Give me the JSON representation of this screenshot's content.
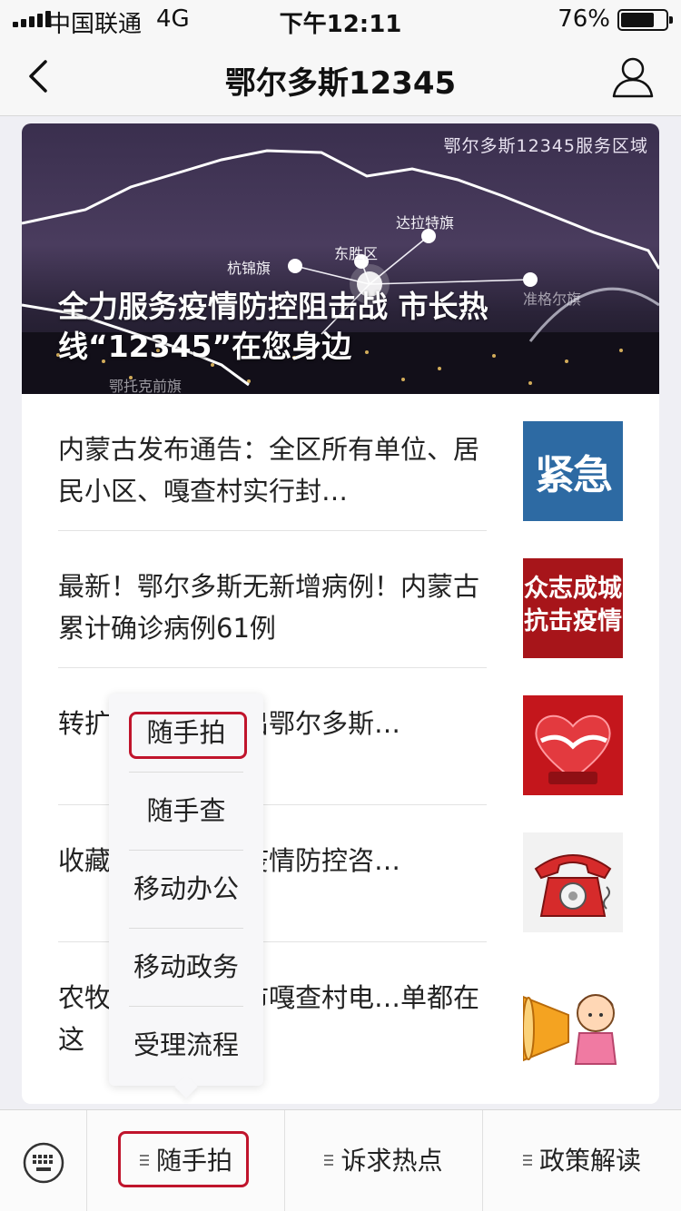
{
  "status_bar": {
    "carrier": "中国联通",
    "network": "4G",
    "time": "下午12:11",
    "battery_percent": "76%",
    "battery_level": 0.76
  },
  "nav": {
    "title": "鄂尔多斯12345",
    "back_icon": "chevron-left-icon",
    "profile_icon": "person-icon"
  },
  "banner": {
    "region_label": "鄂尔多斯12345服务区域",
    "places": [
      "达拉特旗",
      "东胜区",
      "杭锦旗",
      "准格尔旗",
      "鄂托克前旗"
    ],
    "headline": "全力服务疫情防控阻击战 市长热线“12345”在您身边"
  },
  "news": [
    {
      "text": "内蒙古发布通告：全区所有单位、居民小区、嘎查村实行封…",
      "thumb_text": "紧急"
    },
    {
      "text": "最新！鄂尔多斯无新增病例！内蒙古累计确诊病例61例",
      "thumb_text_1": "众志成城",
      "thumb_text_2": "抗击疫情"
    },
    {
      "text": "转扩…车怎么进出鄂尔多斯…"
    },
    {
      "text": "收藏…新冠肺炎疫情防控咨…"
    },
    {
      "text": "农牧…用愁！全市嘎查村电…单都在这"
    }
  ],
  "popup_menu": [
    "随手拍",
    "随手查",
    "移动办公",
    "移动政务",
    "受理流程"
  ],
  "bottom_menu": {
    "keyboard_icon": "keyboard-icon",
    "tabs": [
      "随手拍",
      "诉求热点",
      "政策解读"
    ]
  },
  "colors": {
    "annotation": "#c0142c",
    "background": "#efeff4"
  }
}
